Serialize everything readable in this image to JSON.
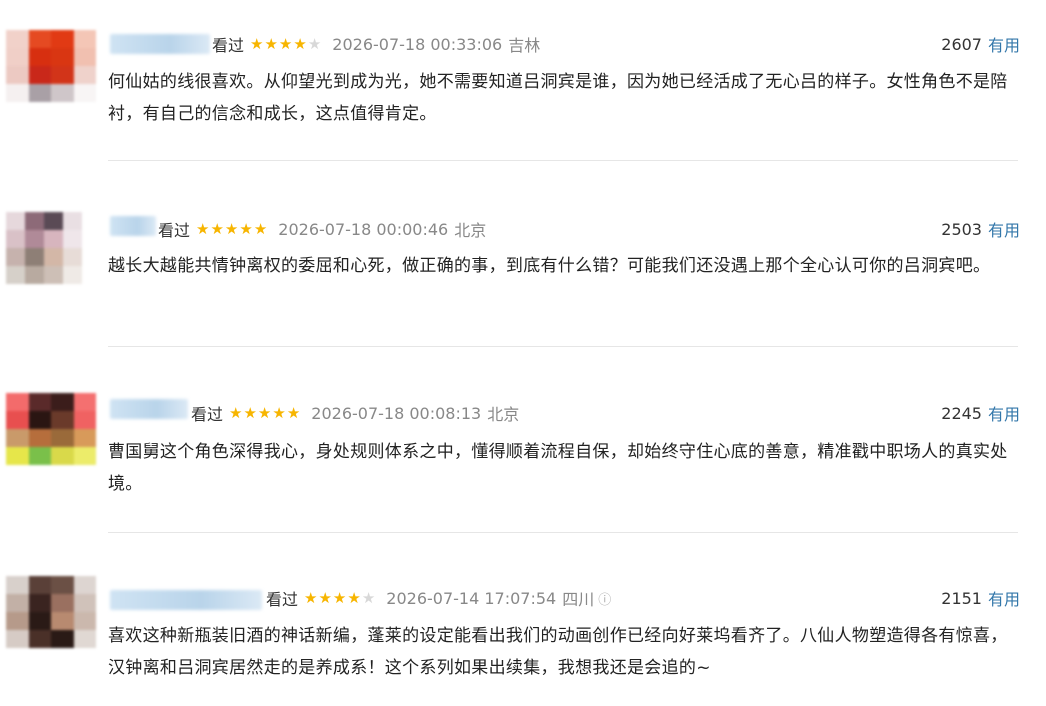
{
  "reviews": [
    {
      "watched_label": "看过",
      "rating": 4,
      "time": "2026-07-18 00:33:06",
      "location": "吉林",
      "vote_count": "2607",
      "useful_label": "有用",
      "content": "何仙姑的线很喜欢。从仰望光到成为光，她不需要知道吕洞宾是谁，因为她已经活成了无心吕的样子。女性角色不是陪衬，有自己的信念和成长，这点值得肯定。"
    },
    {
      "watched_label": "看过",
      "rating": 5,
      "time": "2026-07-18 00:00:46",
      "location": "北京",
      "vote_count": "2503",
      "useful_label": "有用",
      "content": "越长大越能共情钟离权的委屈和心死，做正确的事，到底有什么错？可能我们还没遇上那个全心认可你的吕洞宾吧。"
    },
    {
      "watched_label": "看过",
      "rating": 5,
      "time": "2026-07-18 00:08:13",
      "location": "北京",
      "vote_count": "2245",
      "useful_label": "有用",
      "content": "曹国舅这个角色深得我心，身处规则体系之中，懂得顺着流程自保，却始终守住心底的善意，精准戳中职场人的真实处境。"
    },
    {
      "watched_label": "看过",
      "rating": 4,
      "time": "2026-07-14 17:07:54",
      "location": "四川",
      "location_icon": "info-icon",
      "vote_count": "2151",
      "useful_label": "有用",
      "content": "喜欢这种新瓶装旧酒的神话新编，蓬莱的设定能看出我们的动画创作已经向好莱坞看齐了。八仙人物塑造得各有惊喜，汉钟离和吕洞宾居然走的是养成系！这个系列如果出续集，我想我还是会追的~"
    }
  ],
  "colors": {
    "star": "#f7b500",
    "useful_link": "#3377aa",
    "muted_text": "#888888"
  }
}
